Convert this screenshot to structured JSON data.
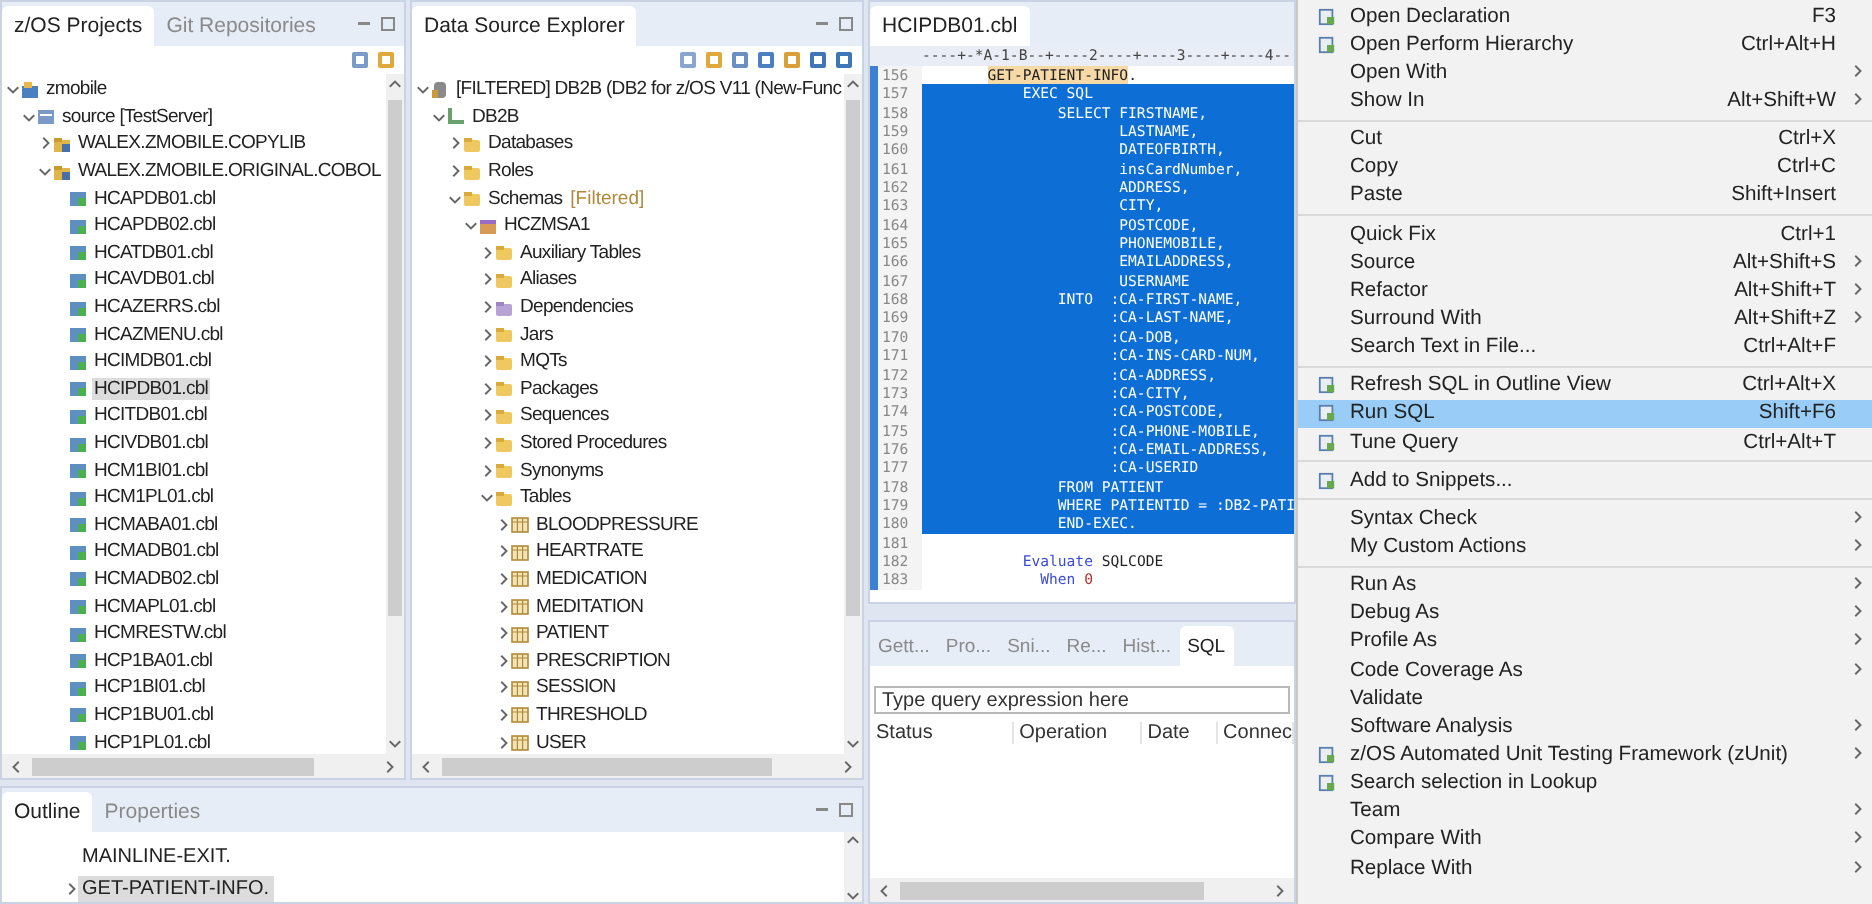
{
  "left_panel": {
    "tabs": [
      {
        "label": "z/OS Projects",
        "selected": true
      },
      {
        "label": "Git Repositories",
        "selected": false
      }
    ],
    "tree": [
      {
        "label": "zmobile",
        "kind": "project",
        "expanded": true,
        "selected": false,
        "children": [
          {
            "label": "source  [TestServer]",
            "kind": "subproject",
            "expanded": true,
            "selected": false,
            "children": [
              {
                "label": "WALEX.ZMOBILE.COPYLIB",
                "kind": "dataset",
                "expanded": false,
                "selected": false
              },
              {
                "label": "WALEX.ZMOBILE.ORIGINAL.COBOL",
                "kind": "dataset",
                "expanded": true,
                "selected": false,
                "children": [
                  {
                    "label": "HCAPDB01.cbl",
                    "kind": "file",
                    "selected": false
                  },
                  {
                    "label": "HCAPDB02.cbl",
                    "kind": "file",
                    "selected": false
                  },
                  {
                    "label": "HCATDB01.cbl",
                    "kind": "file",
                    "selected": false
                  },
                  {
                    "label": "HCAVDB01.cbl",
                    "kind": "file",
                    "selected": false
                  },
                  {
                    "label": "HCAZERRS.cbl",
                    "kind": "file",
                    "selected": false
                  },
                  {
                    "label": "HCAZMENU.cbl",
                    "kind": "file",
                    "selected": false
                  },
                  {
                    "label": "HCIMDB01.cbl",
                    "kind": "file",
                    "selected": false
                  },
                  {
                    "label": "HCIPDB01.cbl",
                    "kind": "file",
                    "selected": true
                  },
                  {
                    "label": "HCITDB01.cbl",
                    "kind": "file",
                    "selected": false
                  },
                  {
                    "label": "HCIVDB01.cbl",
                    "kind": "file",
                    "selected": false
                  },
                  {
                    "label": "HCM1BI01.cbl",
                    "kind": "file",
                    "selected": false
                  },
                  {
                    "label": "HCM1PL01.cbl",
                    "kind": "file",
                    "selected": false
                  },
                  {
                    "label": "HCMABA01.cbl",
                    "kind": "file",
                    "selected": false
                  },
                  {
                    "label": "HCMADB01.cbl",
                    "kind": "file",
                    "selected": false
                  },
                  {
                    "label": "HCMADB02.cbl",
                    "kind": "file",
                    "selected": false
                  },
                  {
                    "label": "HCMAPL01.cbl",
                    "kind": "file",
                    "selected": false
                  },
                  {
                    "label": "HCMRESTW.cbl",
                    "kind": "file",
                    "selected": false
                  },
                  {
                    "label": "HCP1BA01.cbl",
                    "kind": "file",
                    "selected": false
                  },
                  {
                    "label": "HCP1BI01.cbl",
                    "kind": "file",
                    "selected": false
                  },
                  {
                    "label": "HCP1BU01.cbl",
                    "kind": "file",
                    "selected": false
                  },
                  {
                    "label": "HCP1PL01.cbl",
                    "kind": "file",
                    "selected": false
                  }
                ]
              }
            ]
          }
        ]
      }
    ]
  },
  "data_source_explorer": {
    "tabs": [
      {
        "label": "Data Source Explorer",
        "selected": true
      }
    ],
    "tree": [
      {
        "label": "[FILTERED] DB2B (DB2 for z/OS V11 (New-Func",
        "kind": "connection",
        "expanded": true,
        "selected": false,
        "children": [
          {
            "label": "DB2B",
            "kind": "database",
            "expanded": true,
            "selected": false,
            "children": [
              {
                "label": "Databases",
                "kind": "folder",
                "expanded": false,
                "selected": false
              },
              {
                "label": "Roles",
                "kind": "folder",
                "expanded": false,
                "selected": false
              },
              {
                "label": "Schemas",
                "decoration": "[Filtered]",
                "kind": "folder",
                "expanded": true,
                "selected": false,
                "children": [
                  {
                    "label": "HCZMSA1",
                    "kind": "schema",
                    "expanded": true,
                    "selected": false,
                    "children": [
                      {
                        "label": "Auxiliary Tables",
                        "kind": "folder",
                        "expanded": false,
                        "selected": false
                      },
                      {
                        "label": "Aliases",
                        "kind": "folder",
                        "expanded": false,
                        "selected": false
                      },
                      {
                        "label": "Dependencies",
                        "kind": "dependency",
                        "expanded": false,
                        "selected": false
                      },
                      {
                        "label": "Jars",
                        "kind": "folder",
                        "expanded": false,
                        "selected": false
                      },
                      {
                        "label": "MQTs",
                        "kind": "folder",
                        "expanded": false,
                        "selected": false
                      },
                      {
                        "label": "Packages",
                        "kind": "folder",
                        "expanded": false,
                        "selected": false
                      },
                      {
                        "label": "Sequences",
                        "kind": "folder",
                        "expanded": false,
                        "selected": false
                      },
                      {
                        "label": "Stored Procedures",
                        "kind": "folder",
                        "expanded": false,
                        "selected": false
                      },
                      {
                        "label": "Synonyms",
                        "kind": "folder",
                        "expanded": false,
                        "selected": false
                      },
                      {
                        "label": "Tables",
                        "kind": "folder",
                        "expanded": true,
                        "selected": false,
                        "children": [
                          {
                            "label": "BLOODPRESSURE",
                            "kind": "table",
                            "expanded": false,
                            "selected": false
                          },
                          {
                            "label": "HEARTRATE",
                            "kind": "table",
                            "expanded": false,
                            "selected": false
                          },
                          {
                            "label": "MEDICATION",
                            "kind": "table",
                            "expanded": false,
                            "selected": false
                          },
                          {
                            "label": "MEDITATION",
                            "kind": "table",
                            "expanded": false,
                            "selected": false
                          },
                          {
                            "label": "PATIENT",
                            "kind": "table",
                            "expanded": false,
                            "selected": false
                          },
                          {
                            "label": "PRESCRIPTION",
                            "kind": "table",
                            "expanded": false,
                            "selected": false
                          },
                          {
                            "label": "SESSION",
                            "kind": "table",
                            "expanded": false,
                            "selected": false
                          },
                          {
                            "label": "THRESHOLD",
                            "kind": "table",
                            "expanded": false,
                            "selected": false
                          },
                          {
                            "label": "USER",
                            "kind": "table",
                            "expanded": false,
                            "selected": false
                          }
                        ]
                      }
                    ]
                  }
                ]
              }
            ]
          }
        ]
      }
    ]
  },
  "editor": {
    "tabs": [
      {
        "label": "HCIPDB01.cbl",
        "selected": true
      }
    ],
    "ruler": "----+-*A-1-B--+----2----+----3----+----4--",
    "lines": [
      {
        "number": "156",
        "selected": false,
        "segments": [
          {
            "text": "       GET-PATIENT-INFO",
            "kind": "label"
          },
          {
            "text": ".",
            "kind": "plain"
          }
        ]
      },
      {
        "number": "157",
        "selected": true,
        "text": "           EXEC SQL"
      },
      {
        "number": "158",
        "selected": true,
        "text": "               SELECT FIRSTNAME,"
      },
      {
        "number": "159",
        "selected": true,
        "text": "                      LASTNAME,"
      },
      {
        "number": "160",
        "selected": true,
        "text": "                      DATEOFBIRTH,"
      },
      {
        "number": "161",
        "selected": true,
        "text": "                      insCardNumber,"
      },
      {
        "number": "162",
        "selected": true,
        "text": "                      ADDRESS,"
      },
      {
        "number": "163",
        "selected": true,
        "text": "                      CITY,"
      },
      {
        "number": "164",
        "selected": true,
        "text": "                      POSTCODE,"
      },
      {
        "number": "165",
        "selected": true,
        "text": "                      PHONEMOBILE,"
      },
      {
        "number": "166",
        "selected": true,
        "text": "                      EMAILADDRESS,"
      },
      {
        "number": "167",
        "selected": true,
        "text": "                      USERNAME"
      },
      {
        "number": "168",
        "selected": true,
        "text": "               INTO  :CA-FIRST-NAME,"
      },
      {
        "number": "169",
        "selected": true,
        "text": "                     :CA-LAST-NAME,"
      },
      {
        "number": "170",
        "selected": true,
        "text": "                     :CA-DOB,"
      },
      {
        "number": "171",
        "selected": true,
        "text": "                     :CA-INS-CARD-NUM,"
      },
      {
        "number": "172",
        "selected": true,
        "text": "                     :CA-ADDRESS,"
      },
      {
        "number": "173",
        "selected": true,
        "text": "                     :CA-CITY,"
      },
      {
        "number": "174",
        "selected": true,
        "text": "                     :CA-POSTCODE,"
      },
      {
        "number": "175",
        "selected": true,
        "text": "                     :CA-PHONE-MOBILE,"
      },
      {
        "number": "176",
        "selected": true,
        "text": "                     :CA-EMAIL-ADDRESS,"
      },
      {
        "number": "177",
        "selected": true,
        "text": "                     :CA-USERID"
      },
      {
        "number": "178",
        "selected": true,
        "text": "               FROM PATIENT"
      },
      {
        "number": "179",
        "selected": true,
        "text": "               WHERE PATIENTID = :DB2-PATI"
      },
      {
        "number": "180",
        "selected": true,
        "text": "               END-EXEC."
      },
      {
        "number": "181",
        "selected": false
      },
      {
        "number": "182",
        "selected": false,
        "segments": [
          {
            "text": "           Evaluate",
            "kind": "keyword"
          },
          {
            "text": " SQLCODE",
            "kind": "plain"
          }
        ]
      },
      {
        "number": "183",
        "selected": false,
        "segments": [
          {
            "text": "             When",
            "kind": "keyword"
          },
          {
            "text": " 0",
            "kind": "number"
          }
        ]
      }
    ]
  },
  "sql_results": {
    "tabs": [
      {
        "label": "Gett...",
        "selected": false
      },
      {
        "label": "Pro...",
        "selected": false
      },
      {
        "label": "Sni...",
        "selected": false
      },
      {
        "label": "Re...",
        "selected": false
      },
      {
        "label": "Hist...",
        "selected": false
      },
      {
        "label": "SQL",
        "selected": true
      }
    ],
    "search": {
      "placeholder": "Type query expression here"
    },
    "columns": [
      "Status",
      "Operation",
      "Date",
      "Connec"
    ]
  },
  "outline": {
    "tabs": [
      {
        "label": "Outline",
        "selected": true
      },
      {
        "label": "Properties",
        "selected": false
      }
    ],
    "items": [
      {
        "label": "MAINLINE-EXIT.",
        "selected": false
      },
      {
        "label": "GET-PATIENT-INFO.",
        "expanded": false,
        "selected": true
      }
    ]
  },
  "context_menu": {
    "groups": [
      [
        {
          "label": "Open Declaration",
          "shortcut": "F3",
          "icon": true,
          "submenu": false,
          "selected": false
        },
        {
          "label": "Open Perform Hierarchy",
          "shortcut": "Ctrl+Alt+H",
          "icon": true,
          "submenu": false,
          "selected": false
        },
        {
          "label": "Open With",
          "icon": false,
          "submenu": true,
          "selected": false
        },
        {
          "label": "Show In",
          "shortcut": "Alt+Shift+W",
          "icon": false,
          "submenu": true,
          "selected": false
        }
      ],
      [
        {
          "label": "Cut",
          "shortcut": "Ctrl+X",
          "icon": false,
          "submenu": false,
          "selected": false
        },
        {
          "label": "Copy",
          "shortcut": "Ctrl+C",
          "icon": false,
          "submenu": false,
          "selected": false
        },
        {
          "label": "Paste",
          "shortcut": "Shift+Insert",
          "icon": false,
          "submenu": false,
          "selected": false
        }
      ],
      [
        {
          "label": "Quick Fix",
          "shortcut": "Ctrl+1",
          "icon": false,
          "submenu": false,
          "selected": false
        },
        {
          "label": "Source",
          "shortcut": "Alt+Shift+S",
          "icon": false,
          "submenu": true,
          "selected": false
        },
        {
          "label": "Refactor",
          "shortcut": "Alt+Shift+T",
          "icon": false,
          "submenu": true,
          "selected": false
        },
        {
          "label": "Surround With",
          "shortcut": "Alt+Shift+Z",
          "icon": false,
          "submenu": true,
          "selected": false
        },
        {
          "label": "Search Text in File...",
          "shortcut": "Ctrl+Alt+F",
          "icon": false,
          "submenu": false,
          "selected": false
        }
      ],
      [
        {
          "label": "Refresh SQL in Outline View",
          "shortcut": "Ctrl+Alt+X",
          "icon": true,
          "submenu": false,
          "selected": false
        },
        {
          "label": "Run SQL",
          "shortcut": "Shift+F6",
          "icon": true,
          "submenu": false,
          "selected": true
        },
        {
          "label": "Tune Query",
          "shortcut": "Ctrl+Alt+T",
          "icon": true,
          "submenu": false,
          "selected": false
        }
      ],
      [
        {
          "label": "Add to Snippets...",
          "icon": true,
          "submenu": false,
          "selected": false
        }
      ],
      [
        {
          "label": "Syntax Check",
          "icon": false,
          "submenu": true,
          "selected": false
        },
        {
          "label": "My Custom Actions",
          "icon": false,
          "submenu": true,
          "selected": false
        }
      ],
      [
        {
          "label": "Run As",
          "icon": false,
          "submenu": true,
          "selected": false
        },
        {
          "label": "Debug As",
          "icon": false,
          "submenu": true,
          "selected": false
        },
        {
          "label": "Profile As",
          "icon": false,
          "submenu": true,
          "selected": false
        },
        {
          "label": "Code Coverage As",
          "icon": false,
          "submenu": true,
          "selected": false
        },
        {
          "label": "Validate",
          "icon": false,
          "submenu": false,
          "selected": false
        },
        {
          "label": "Software Analysis",
          "icon": false,
          "submenu": true,
          "selected": false
        },
        {
          "label": "z/OS Automated Unit Testing Framework (zUnit)",
          "icon": true,
          "submenu": true,
          "selected": false
        },
        {
          "label": "Search selection in Lookup",
          "icon": true,
          "submenu": false,
          "selected": false
        },
        {
          "label": "Team",
          "icon": false,
          "submenu": true,
          "selected": false
        },
        {
          "label": "Compare With",
          "icon": false,
          "submenu": true,
          "selected": false
        },
        {
          "label": "Replace With",
          "icon": false,
          "submenu": true,
          "selected": false
        }
      ]
    ]
  }
}
